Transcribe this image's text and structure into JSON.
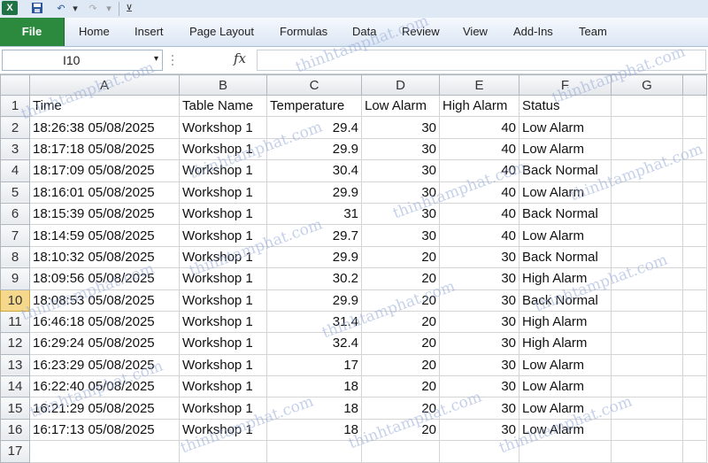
{
  "qat": {
    "app_icon": "X",
    "undo_glyph": "↶",
    "redo_glyph": "↷",
    "dropdown_glyph": "▾",
    "customize_glyph": "⊻"
  },
  "ribbon": {
    "tabs": [
      {
        "label": "File"
      },
      {
        "label": "Home"
      },
      {
        "label": "Insert"
      },
      {
        "label": "Page Layout"
      },
      {
        "label": "Formulas"
      },
      {
        "label": "Data"
      },
      {
        "label": "Review"
      },
      {
        "label": "View"
      },
      {
        "label": "Add-Ins"
      },
      {
        "label": "Team"
      }
    ],
    "active_tab_color": "#2c8a3e"
  },
  "formula_bar": {
    "name_box": "I10",
    "fx_label": "fx",
    "formula": ""
  },
  "sheet": {
    "columns": [
      "A",
      "B",
      "C",
      "D",
      "E",
      "F",
      "G"
    ],
    "selected_row": "10",
    "header_row": {
      "row": "1",
      "cells": [
        "Time",
        "Table Name",
        "Temperature",
        "Low Alarm",
        "High Alarm",
        "Status",
        ""
      ]
    },
    "rows": [
      {
        "row": "2",
        "cells": [
          "18:26:38 05/08/2025",
          "Workshop 1",
          "29.4",
          "30",
          "40",
          "Low Alarm",
          ""
        ]
      },
      {
        "row": "3",
        "cells": [
          "18:17:18 05/08/2025",
          "Workshop 1",
          "29.9",
          "30",
          "40",
          "Low Alarm",
          ""
        ]
      },
      {
        "row": "4",
        "cells": [
          "18:17:09 05/08/2025",
          "Workshop 1",
          "30.4",
          "30",
          "40",
          "Back Normal",
          ""
        ]
      },
      {
        "row": "5",
        "cells": [
          "18:16:01 05/08/2025",
          "Workshop 1",
          "29.9",
          "30",
          "40",
          "Low Alarm",
          ""
        ]
      },
      {
        "row": "6",
        "cells": [
          "18:15:39 05/08/2025",
          "Workshop 1",
          "31",
          "30",
          "40",
          "Back Normal",
          ""
        ]
      },
      {
        "row": "7",
        "cells": [
          "18:14:59 05/08/2025",
          "Workshop 1",
          "29.7",
          "30",
          "40",
          "Low Alarm",
          ""
        ]
      },
      {
        "row": "8",
        "cells": [
          "18:10:32 05/08/2025",
          "Workshop 1",
          "29.9",
          "20",
          "30",
          "Back Normal",
          ""
        ]
      },
      {
        "row": "9",
        "cells": [
          "18:09:56 05/08/2025",
          "Workshop 1",
          "30.2",
          "20",
          "30",
          "High Alarm",
          ""
        ]
      },
      {
        "row": "10",
        "cells": [
          "18:08:53 05/08/2025",
          "Workshop 1",
          "29.9",
          "20",
          "30",
          "Back Normal",
          ""
        ]
      },
      {
        "row": "11",
        "cells": [
          "16:46:18 05/08/2025",
          "Workshop 1",
          "31.4",
          "20",
          "30",
          "High Alarm",
          ""
        ]
      },
      {
        "row": "12",
        "cells": [
          "16:29:24 05/08/2025",
          "Workshop 1",
          "32.4",
          "20",
          "30",
          "High Alarm",
          ""
        ]
      },
      {
        "row": "13",
        "cells": [
          "16:23:29 05/08/2025",
          "Workshop 1",
          "17",
          "20",
          "30",
          "Low Alarm",
          ""
        ]
      },
      {
        "row": "14",
        "cells": [
          "16:22:40 05/08/2025",
          "Workshop 1",
          "18",
          "20",
          "30",
          "Low Alarm",
          ""
        ]
      },
      {
        "row": "15",
        "cells": [
          "16:21:29 05/08/2025",
          "Workshop 1",
          "18",
          "20",
          "30",
          "Low Alarm",
          ""
        ]
      },
      {
        "row": "16",
        "cells": [
          "16:17:13 05/08/2025",
          "Workshop 1",
          "18",
          "20",
          "30",
          "Low Alarm",
          ""
        ]
      },
      {
        "row": "17",
        "cells": [
          "",
          "",
          "",
          "",
          "",
          "",
          ""
        ]
      }
    ]
  },
  "watermark": {
    "text": "thinhtamphat.com"
  }
}
